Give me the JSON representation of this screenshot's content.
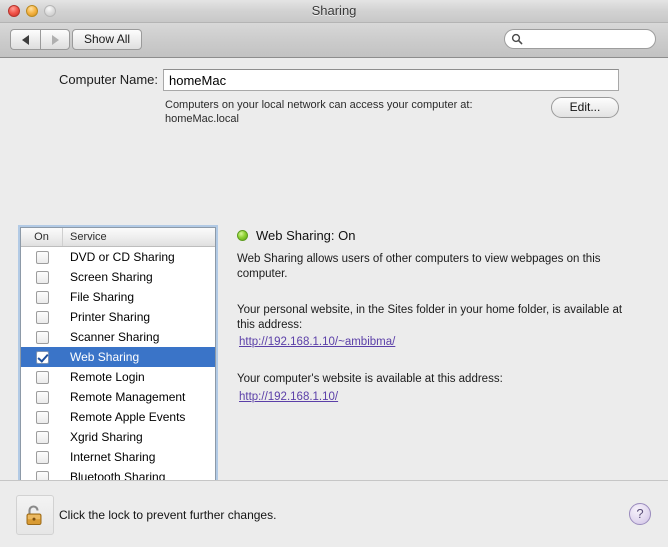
{
  "window": {
    "title": "Sharing",
    "traffic_lights": [
      "close",
      "minimize",
      "zoom"
    ]
  },
  "toolbar": {
    "back_label": "",
    "forward_label": "",
    "show_all_label": "Show All",
    "search": {
      "value": "",
      "placeholder": ""
    }
  },
  "computer_name": {
    "label": "Computer Name:",
    "value": "homeMac",
    "hint": "Computers on your local network can access your computer at: homeMac.local",
    "edit_label": "Edit..."
  },
  "services_list": {
    "headers": {
      "on": "On",
      "service": "Service"
    },
    "rows": [
      {
        "name": "DVD or CD Sharing",
        "checked": false,
        "selected": false
      },
      {
        "name": "Screen Sharing",
        "checked": false,
        "selected": false
      },
      {
        "name": "File Sharing",
        "checked": false,
        "selected": false
      },
      {
        "name": "Printer Sharing",
        "checked": false,
        "selected": false
      },
      {
        "name": "Scanner Sharing",
        "checked": false,
        "selected": false
      },
      {
        "name": "Web Sharing",
        "checked": true,
        "selected": true
      },
      {
        "name": "Remote Login",
        "checked": false,
        "selected": false
      },
      {
        "name": "Remote Management",
        "checked": false,
        "selected": false
      },
      {
        "name": "Remote Apple Events",
        "checked": false,
        "selected": false
      },
      {
        "name": "Xgrid Sharing",
        "checked": false,
        "selected": false
      },
      {
        "name": "Internet Sharing",
        "checked": false,
        "selected": false
      },
      {
        "name": "Bluetooth Sharing",
        "checked": false,
        "selected": false
      }
    ]
  },
  "detail": {
    "status_title": "Web Sharing: On",
    "status_color": "#8fd233",
    "description": "Web Sharing allows users of other computers to view webpages on this computer.",
    "personal_site_lead": "Your personal website, in the Sites folder in your home folder, is available at this address:",
    "personal_site_url": "http://192.168.1.10/~ambibma/",
    "computer_site_lead": "Your computer's website is available at this address:",
    "computer_site_url": "http://192.168.1.10/",
    "link_color": "#5b3fa8"
  },
  "bottom": {
    "lock_state": "unlocked",
    "lock_message": "Click the lock to prevent further changes.",
    "help_label": "?"
  }
}
